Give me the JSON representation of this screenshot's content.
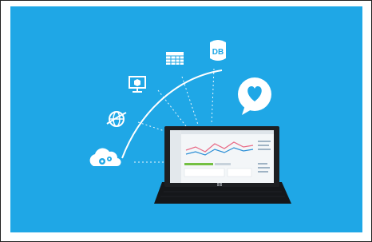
{
  "colors": {
    "background": "#1fa7e6",
    "foreground": "#ffffff",
    "device_dark": "#1d1f22",
    "screen_light": "#f3f6f8",
    "chart_pink": "#e86a86",
    "chart_blue": "#2c8fd6",
    "chart_green": "#74c043"
  },
  "icons": [
    {
      "name": "cloud-gears-icon"
    },
    {
      "name": "globe-icon"
    },
    {
      "name": "monitor-cube-icon"
    },
    {
      "name": "table-grid-icon"
    },
    {
      "name": "database-icon"
    },
    {
      "name": "heart-speech-bubble-icon"
    }
  ],
  "db_icon_label": "DB"
}
